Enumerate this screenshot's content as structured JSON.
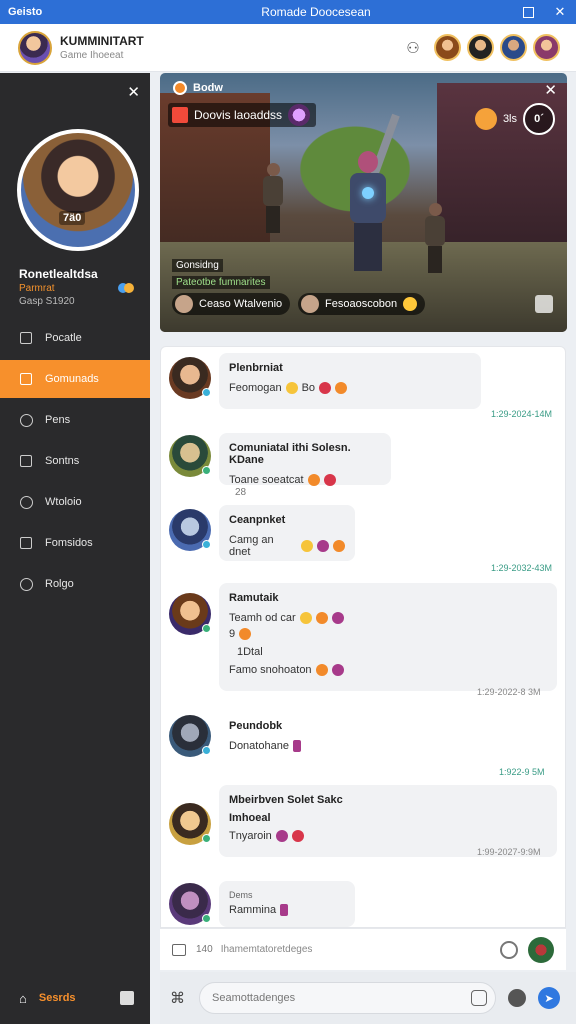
{
  "window": {
    "app_label": "Geisto",
    "title": "Romade Doocesean",
    "maximize_icon": "maximize-icon"
  },
  "header": {
    "name": "KUMMINITART",
    "subtitle": "Game Ihoeeat",
    "add_friend_icon": "user-add-icon"
  },
  "sidebar": {
    "profile_name": "Ronetlealtdsa",
    "profile_role": "Parmrat",
    "profile_game": "Gasp S1920",
    "level_badge": "7ä0",
    "items": [
      {
        "label": "Pocatle",
        "icon": "square-icon",
        "active": false
      },
      {
        "label": "Gomunads",
        "icon": "square-icon",
        "active": true
      },
      {
        "label": "Pens",
        "icon": "shield-icon",
        "active": false
      },
      {
        "label": "Sontns",
        "icon": "grid-icon",
        "active": false
      },
      {
        "label": "Wtoloio",
        "icon": "chat-icon",
        "active": false
      },
      {
        "label": "Fomsidos",
        "icon": "folder-icon",
        "active": false
      },
      {
        "label": "Rolgo",
        "icon": "gear-icon",
        "active": false
      }
    ],
    "bottom_label": "Sesrds"
  },
  "game": {
    "live_label": "Bodw",
    "party_label": "Doovis laoaddss",
    "stat_text": "3ls",
    "ring_text": "0´",
    "label1": "Gonsidng",
    "label2": "Pateotbe fumnarites",
    "chip1": "Ceaso Wtalvenio",
    "chip2": "Fesoaoscobon"
  },
  "chat": {
    "messages": [
      {
        "name": "Plenbrniat",
        "text": "Feomogan",
        "emoji_text": "Bo",
        "time": "1:29-2024-14M"
      },
      {
        "name": "Comuniatal ithi Solesn. KDane",
        "text": "Toane soeatcat",
        "count": "28"
      },
      {
        "name": "Ceanpnket",
        "text": "Camg an dnet",
        "time": "1:29-2032-43M"
      },
      {
        "name": "Ramutaik",
        "text": "Teamh od car",
        "line2": "9",
        "line3": "1Dtal",
        "line4": "Famo snohoaton",
        "time": "1:29-2022-8 3M"
      },
      {
        "name": "Peundobk",
        "text": "Donatohane",
        "time": "1:922-9 5M"
      },
      {
        "name": "Mbeirbven Solet Sakc",
        "name2": "Imhoeal",
        "text": "Tnyaroin",
        "time": "1:99-2027-9:9M"
      },
      {
        "name": "Dems",
        "name2": "Rammina",
        "text": ""
      }
    ],
    "input_count": "140",
    "input_placeholder": "Ihamemtatoretdeges"
  },
  "compose": {
    "placeholder": "Seamottadenges"
  }
}
